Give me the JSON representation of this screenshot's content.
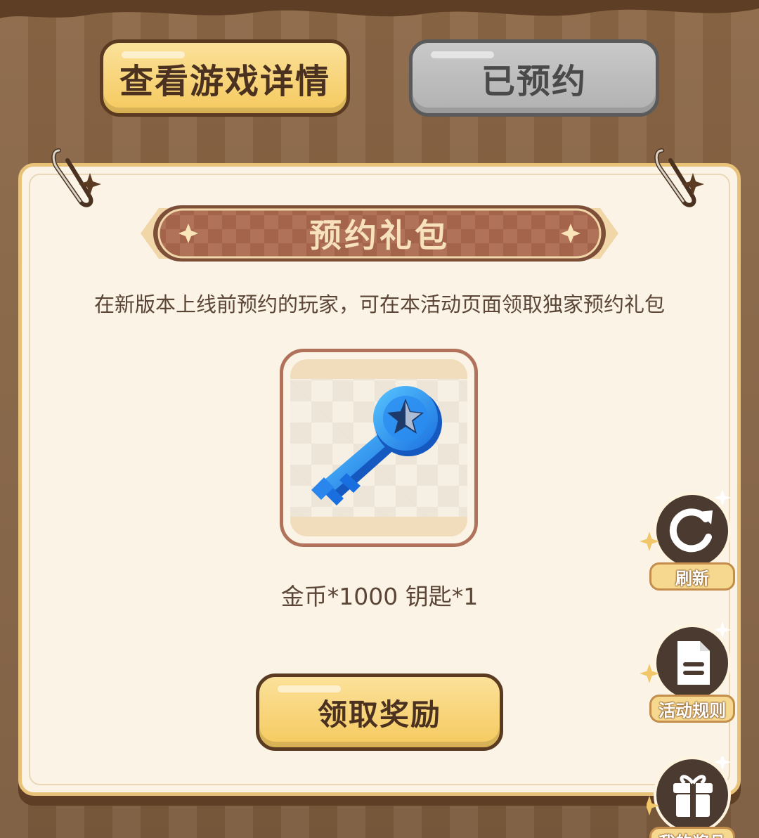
{
  "header": {
    "details_button": "查看游戏详情",
    "reserved_button": "已预约"
  },
  "panel": {
    "title": "预约礼包",
    "description": "在新版本上线前预约的玩家，可在本活动页面领取独家预约礼包",
    "reward_text": "金币*1000 钥匙*1",
    "claim_button": "领取奖励",
    "item_icon": "blue-star-key-icon"
  },
  "side_menu": {
    "refresh": "刷新",
    "rules": "活动规则",
    "my_prizes": "我的奖品"
  },
  "colors": {
    "background": "#7b5a3c",
    "panel": "#fbf4e6",
    "gold_button": "#f5c95e",
    "disabled_button": "#b1b1b1",
    "ribbon": "#a8664f",
    "text": "#5b4536"
  }
}
